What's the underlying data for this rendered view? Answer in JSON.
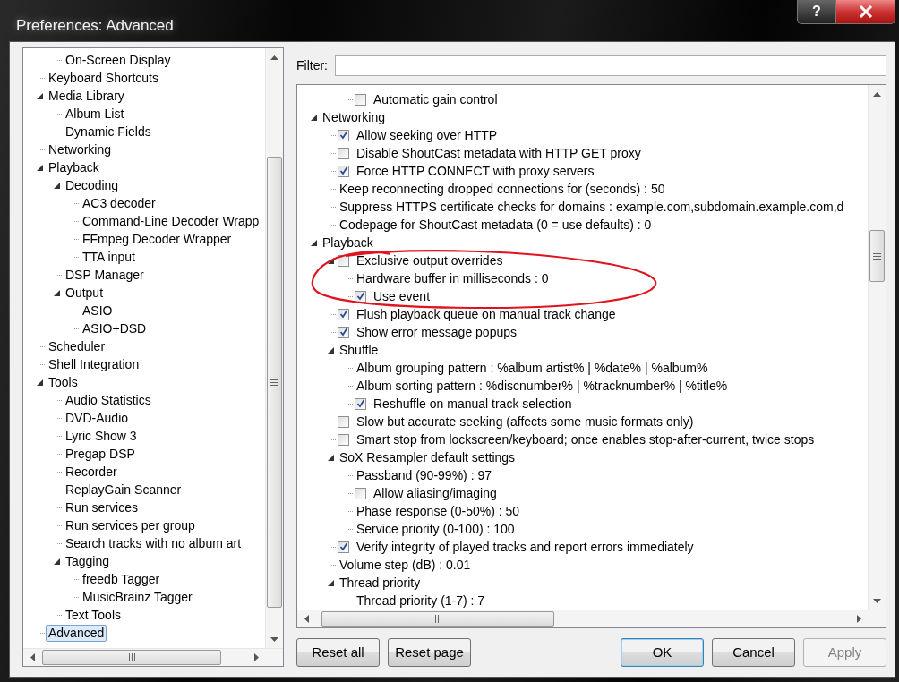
{
  "window": {
    "title": "Preferences: Advanced",
    "help_button": "?"
  },
  "pages_tree": {
    "continued_children": [
      {
        "label": "On-Screen Display",
        "selected": false
      }
    ],
    "items": [
      {
        "label": "Keyboard Shortcuts",
        "selected": false
      },
      {
        "label": "Media Library",
        "selected": false,
        "expanded": true,
        "children": [
          {
            "label": "Album List",
            "selected": false
          },
          {
            "label": "Dynamic Fields",
            "selected": false
          }
        ]
      },
      {
        "label": "Networking",
        "selected": false
      },
      {
        "label": "Playback",
        "selected": false,
        "expanded": true,
        "children": [
          {
            "label": "Decoding",
            "selected": false,
            "expanded": true,
            "children": [
              {
                "label": "AC3 decoder",
                "selected": false
              },
              {
                "label": "Command-Line Decoder Wrapp",
                "selected": false
              },
              {
                "label": "FFmpeg Decoder Wrapper",
                "selected": false
              },
              {
                "label": "TTA input",
                "selected": false
              }
            ]
          },
          {
            "label": "DSP Manager",
            "selected": false
          },
          {
            "label": "Output",
            "selected": false,
            "expanded": true,
            "children": [
              {
                "label": "ASIO",
                "selected": false
              },
              {
                "label": "ASIO+DSD",
                "selected": false
              }
            ]
          }
        ]
      },
      {
        "label": "Scheduler",
        "selected": false
      },
      {
        "label": "Shell Integration",
        "selected": false
      },
      {
        "label": "Tools",
        "selected": false,
        "expanded": true,
        "children": [
          {
            "label": "Audio Statistics",
            "selected": false
          },
          {
            "label": "DVD-Audio",
            "selected": false
          },
          {
            "label": "Lyric Show 3",
            "selected": false
          },
          {
            "label": "Pregap DSP",
            "selected": false
          },
          {
            "label": "Recorder",
            "selected": false
          },
          {
            "label": "ReplayGain Scanner",
            "selected": false
          },
          {
            "label": "Run services",
            "selected": false
          },
          {
            "label": "Run services per group",
            "selected": false
          },
          {
            "label": "Search tracks with no album art",
            "selected": false
          },
          {
            "label": "Tagging",
            "selected": false,
            "expanded": true,
            "children": [
              {
                "label": "freedb Tagger",
                "selected": false
              },
              {
                "label": "MusicBrainz Tagger",
                "selected": false
              }
            ]
          },
          {
            "label": "Text Tools",
            "selected": false
          }
        ]
      },
      {
        "label": "Advanced",
        "selected": true
      }
    ]
  },
  "filter": {
    "label": "Filter:"
  },
  "settings_tree": {
    "continued_children": [
      {
        "kind": "checkbox",
        "label": "Automatic gain control",
        "checked": false
      }
    ],
    "items": [
      {
        "kind": "group",
        "label": "Networking",
        "expanded": true,
        "children": [
          {
            "kind": "checkbox",
            "label": "Allow seeking over HTTP",
            "checked": true
          },
          {
            "kind": "checkbox",
            "label": "Disable ShoutCast metadata with HTTP GET proxy",
            "checked": false
          },
          {
            "kind": "checkbox",
            "label": "Force HTTP CONNECT with proxy servers",
            "checked": true
          },
          {
            "kind": "value",
            "label": "Keep reconnecting dropped connections for (seconds) : 50"
          },
          {
            "kind": "value",
            "label": "Suppress HTTPS certificate checks for domains : example.com,subdomain.example.com,d"
          },
          {
            "kind": "value",
            "label": "Codepage for ShoutCast metadata (0 = use defaults) : 0"
          }
        ]
      },
      {
        "kind": "group",
        "label": "Playback",
        "expanded": true,
        "children": [
          {
            "kind": "checkbox",
            "label": "Exclusive output overrides",
            "checked": false,
            "expanded": true,
            "children": [
              {
                "kind": "value",
                "label": "Hardware buffer in milliseconds : 0"
              },
              {
                "kind": "checkbox",
                "label": "Use event",
                "checked": true
              }
            ]
          },
          {
            "kind": "checkbox",
            "label": "Flush playback queue on manual track change",
            "checked": true
          },
          {
            "kind": "checkbox",
            "label": "Show error message popups",
            "checked": true
          },
          {
            "kind": "group",
            "label": "Shuffle",
            "expanded": true,
            "children": [
              {
                "kind": "value",
                "label": "Album grouping pattern : %album artist% | %date% | %album%"
              },
              {
                "kind": "value",
                "label": "Album sorting pattern : %discnumber% | %tracknumber% | %title%"
              },
              {
                "kind": "checkbox",
                "label": "Reshuffle on manual track selection",
                "checked": true
              }
            ]
          },
          {
            "kind": "checkbox",
            "label": "Slow but accurate seeking (affects some music formats only)",
            "checked": false
          },
          {
            "kind": "checkbox",
            "label": "Smart stop from lockscreen/keyboard; once enables stop-after-current, twice stops",
            "checked": false
          },
          {
            "kind": "group",
            "label": "SoX Resampler default settings",
            "expanded": true,
            "children": [
              {
                "kind": "value",
                "label": "Passband (90-99%) : 97"
              },
              {
                "kind": "checkbox",
                "label": "Allow aliasing/imaging",
                "checked": false
              },
              {
                "kind": "value",
                "label": "Phase response (0-50%) : 50"
              },
              {
                "kind": "value",
                "label": "Service priority (0-100) : 100"
              }
            ]
          },
          {
            "kind": "checkbox",
            "label": "Verify integrity of played tracks and report errors immediately",
            "checked": true
          },
          {
            "kind": "value",
            "label": "Volume step (dB) : 0.01"
          },
          {
            "kind": "group",
            "label": "Thread priority",
            "expanded": true,
            "children": [
              {
                "kind": "value",
                "label": "Thread priority (1-7) : 7"
              }
            ]
          }
        ]
      }
    ]
  },
  "buttons": [
    {
      "label": "Reset all",
      "kind": "normal"
    },
    {
      "label": "Reset page",
      "kind": "normal"
    },
    {
      "label": "OK",
      "kind": "default"
    },
    {
      "label": "Cancel",
      "kind": "normal"
    },
    {
      "label": "Apply",
      "kind": "disabled"
    }
  ]
}
